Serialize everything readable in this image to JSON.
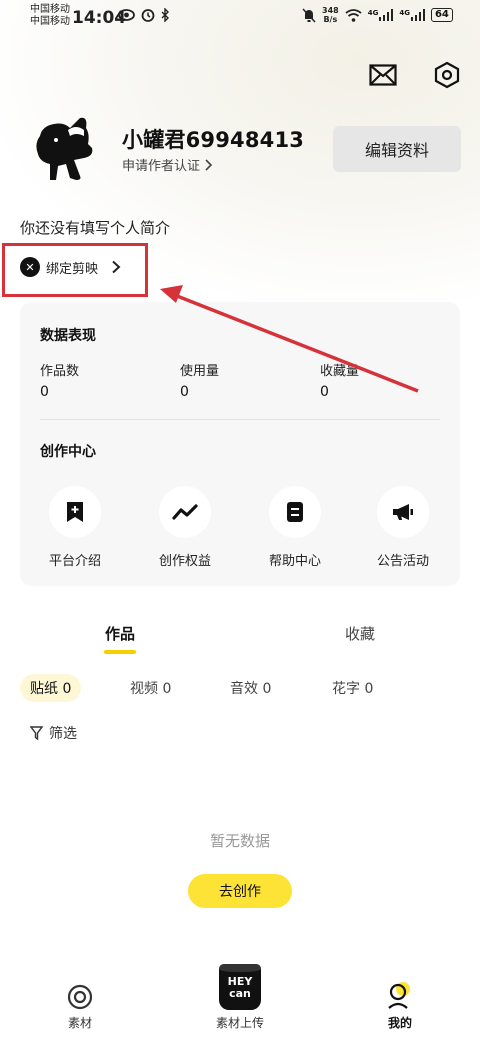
{
  "status_bar": {
    "carrier1": "中国移动",
    "carrier2": "中国移动",
    "time": "14:04",
    "speed_value": "348",
    "speed_unit": "B/s",
    "net1": "4G",
    "net2": "4G",
    "battery": "64"
  },
  "header": {
    "mail_icon": "mail-icon",
    "settings_icon": "settings-icon"
  },
  "profile": {
    "username": "小罐君69948413",
    "author_link": "申请作者认证",
    "edit_button": "编辑资料",
    "bio": "你还没有填写个人简介",
    "bind_label": "绑定剪映"
  },
  "stats": {
    "title": "数据表现",
    "items": [
      {
        "label": "作品数",
        "value": "0"
      },
      {
        "label": "使用量",
        "value": "0"
      },
      {
        "label": "收藏量",
        "value": "0"
      }
    ]
  },
  "creator_center": {
    "title": "创作中心",
    "items": [
      {
        "label": "平台介绍",
        "icon": "bookmark-plus-icon"
      },
      {
        "label": "创作权益",
        "icon": "trend-icon"
      },
      {
        "label": "帮助中心",
        "icon": "document-icon"
      },
      {
        "label": "公告活动",
        "icon": "megaphone-icon"
      }
    ]
  },
  "tabs": [
    {
      "label": "作品",
      "active": true
    },
    {
      "label": "收藏",
      "active": false
    }
  ],
  "chips": [
    {
      "label": "贴纸 0",
      "active": true
    },
    {
      "label": "视频 0",
      "active": false
    },
    {
      "label": "音效 0",
      "active": false
    },
    {
      "label": "花字 0",
      "active": false
    }
  ],
  "filter_label": "筛选",
  "empty_text": "暂无数据",
  "create_button": "去创作",
  "bottom_nav": [
    {
      "label": "素材",
      "icon": "circle-target-icon",
      "active": false
    },
    {
      "label": "素材上传",
      "icon": "heycan-logo",
      "active": false
    },
    {
      "label": "我的",
      "icon": "profile-icon",
      "active": true
    }
  ],
  "logo_text": "HEY can",
  "colors": {
    "accent_yellow": "#fce335",
    "annotation_red": "#d6323a"
  }
}
